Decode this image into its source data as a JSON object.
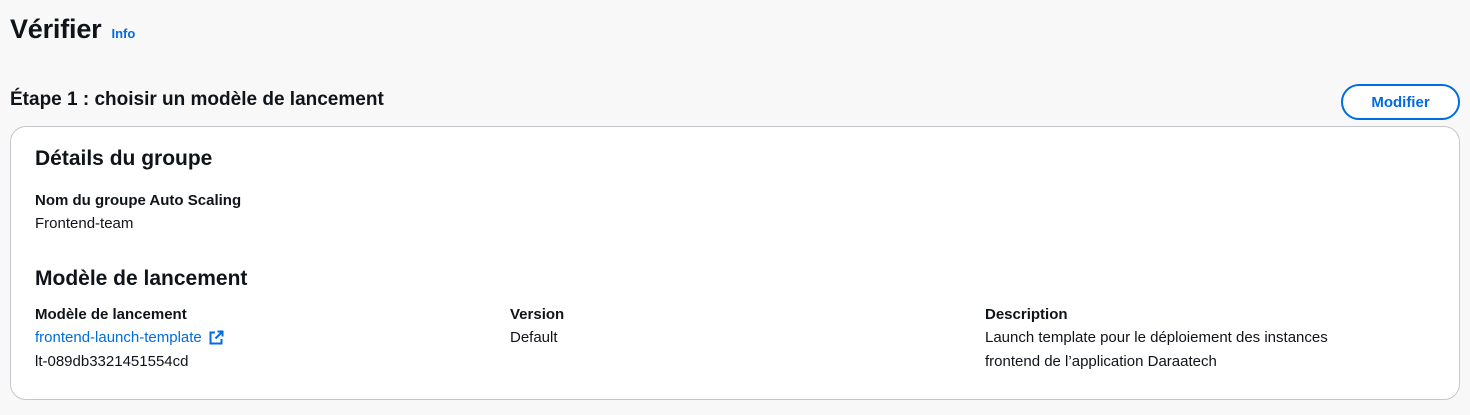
{
  "header": {
    "title": "Vérifier",
    "info_label": "Info"
  },
  "step": {
    "title": "Étape 1 : choisir un modèle de lancement",
    "edit_label": "Modifier"
  },
  "group_details": {
    "heading": "Détails du groupe",
    "name_label": "Nom du groupe Auto Scaling",
    "name_value": "Frontend-team"
  },
  "launch_template": {
    "heading": "Modèle de lancement",
    "template_label": "Modèle de lancement",
    "template_link": "frontend-launch-template",
    "template_id": "lt-089db3321451554cd",
    "version_label": "Version",
    "version_value": "Default",
    "description_label": "Description",
    "description_line1": "Launch template pour le déploiement des instances",
    "description_line2": "frontend de l’application Daraatech"
  },
  "colors": {
    "link": "#006ce0",
    "text": "#0f141a",
    "border": "#c6c6cd",
    "background": "#f8f8f8"
  },
  "icons": {
    "external_link": "external-link-icon"
  }
}
